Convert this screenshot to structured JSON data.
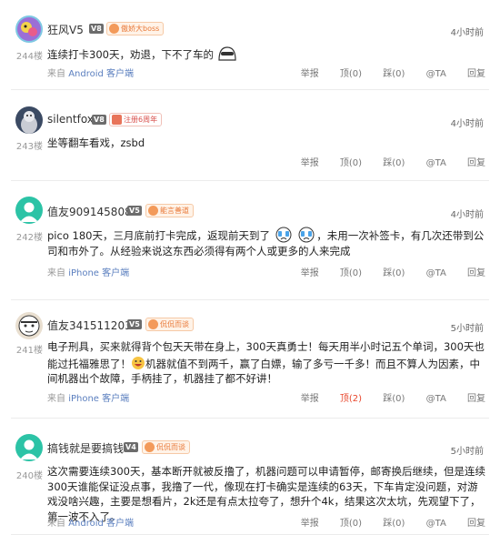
{
  "comments": [
    {
      "username": "狂风V5",
      "level": "V8",
      "badge": "傲娇大boss",
      "time": "4小时前",
      "floor": "244楼",
      "text": "连续打卡300天，劝退，下不了车的",
      "source_prefix": "来自",
      "source_client": "Android 客户端",
      "actions": {
        "report": "举报",
        "up": "顶(0)",
        "down": "踩(0)",
        "ta": "@TA",
        "reply": "回复"
      }
    },
    {
      "username": "silentfox",
      "level": "V8",
      "badge": "注册6周年",
      "time": "4小时前",
      "floor": "243楼",
      "text": "坐等翻车看戏，zsbd",
      "source_prefix": "",
      "source_client": "",
      "actions": {
        "report": "举报",
        "up": "顶(0)",
        "down": "踩(0)",
        "ta": "@TA",
        "reply": "回复"
      }
    },
    {
      "username": "值友9091458085",
      "level": "V5",
      "badge": "能言善道",
      "time": "4小时前",
      "floor": "242楼",
      "text_before": "pico 180天，三月底前打卡完成，返现前天到了",
      "text_after": "，未用一次补签卡，有几次还带到公司和市外了。从经验来说这东西必须得有两个人或更多的人来完成",
      "source_prefix": "来自",
      "source_client": "iPhone 客户端",
      "actions": {
        "report": "举报",
        "up": "顶(0)",
        "down": "踩(0)",
        "ta": "@TA",
        "reply": "回复"
      }
    },
    {
      "username": "值友3415112031",
      "level": "V5",
      "badge": "侃侃而谈",
      "time": "5小时前",
      "floor": "241楼",
      "text_before": "电子刑具，买来就得背个包天天带在身上，300天真勇士！每天用半小时记五个单词，300天也能过托福雅思了！",
      "text_after": "机器就值不到两千，赢了白嫖，输了多亏一千多！而且不算人为因素，中间机器出个故障，手柄挂了，机器挂了都不好讲！",
      "source_prefix": "来自",
      "source_client": "iPhone 客户端",
      "actions": {
        "report": "举报",
        "up": "顶(2)",
        "down": "踩(0)",
        "ta": "@TA",
        "reply": "回复"
      }
    },
    {
      "username": "搞钱就是要搞钱",
      "level": "V4",
      "badge": "侃侃而谈",
      "time": "5小时前",
      "floor": "240楼",
      "text": "这次需要连续300天，基本断开就被反撸了，机器问题可以申请暂停，邮寄换后继续，但是连续300天谁能保证没点事，我撸了一代，像现在打卡确实是连续的63天，下车肯定没问题，对游戏没啥兴趣，主要是想看片，2k还是有点太拉夸了，想升个4k，结果这次太坑，先观望下了，第一波不入了。",
      "source_prefix": "来自",
      "source_client": "Android 客户端",
      "actions": {
        "report": "举报",
        "up": "顶(0)",
        "down": "踩(0)",
        "ta": "@TA",
        "reply": "回复"
      }
    }
  ]
}
